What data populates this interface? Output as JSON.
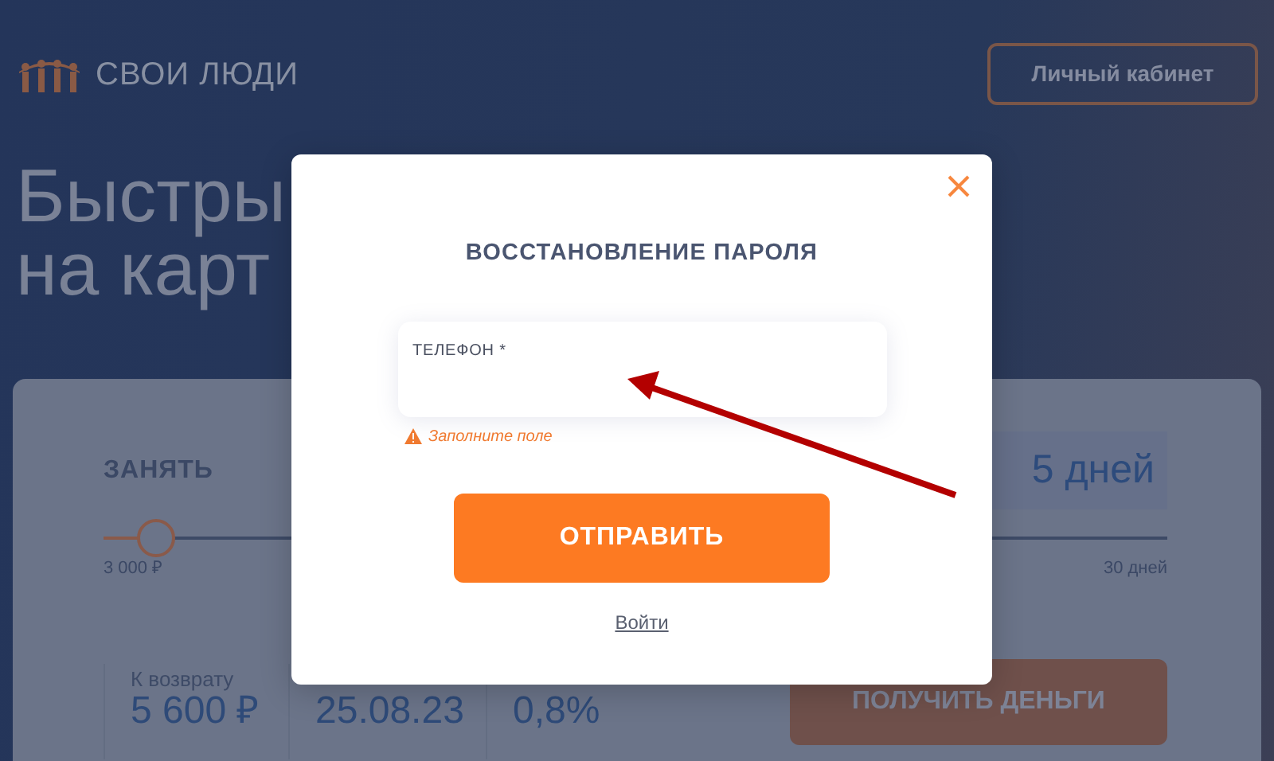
{
  "header": {
    "logo_text": "СВОИ ЛЮДИ",
    "account_button": "Личный кабинет"
  },
  "hero": {
    "title_lines": [
      "Быстры",
      "на карт"
    ]
  },
  "calculator": {
    "amount": {
      "label": "ЗАНЯТЬ",
      "level": 0.05,
      "min_label": "3 000 ₽"
    },
    "term": {
      "value": "5 дней",
      "max_label": "30 дней"
    },
    "stats": [
      {
        "label": "К возврату",
        "value": "5 600 ₽"
      },
      {
        "value": "25.08.23"
      },
      {
        "value": "0,8%"
      }
    ],
    "submit_button": "ПОЛУЧИТЬ ДЕНЬГИ"
  },
  "modal": {
    "title": "ВОССТАНОВЛЕНИЕ ПАРОЛЯ",
    "fields": [
      {
        "label": "ТЕЛЕФОН *",
        "error": "Заполните поле"
      }
    ],
    "submit_button": "ОТПРАВИТЬ",
    "login_link": "Войти"
  }
}
